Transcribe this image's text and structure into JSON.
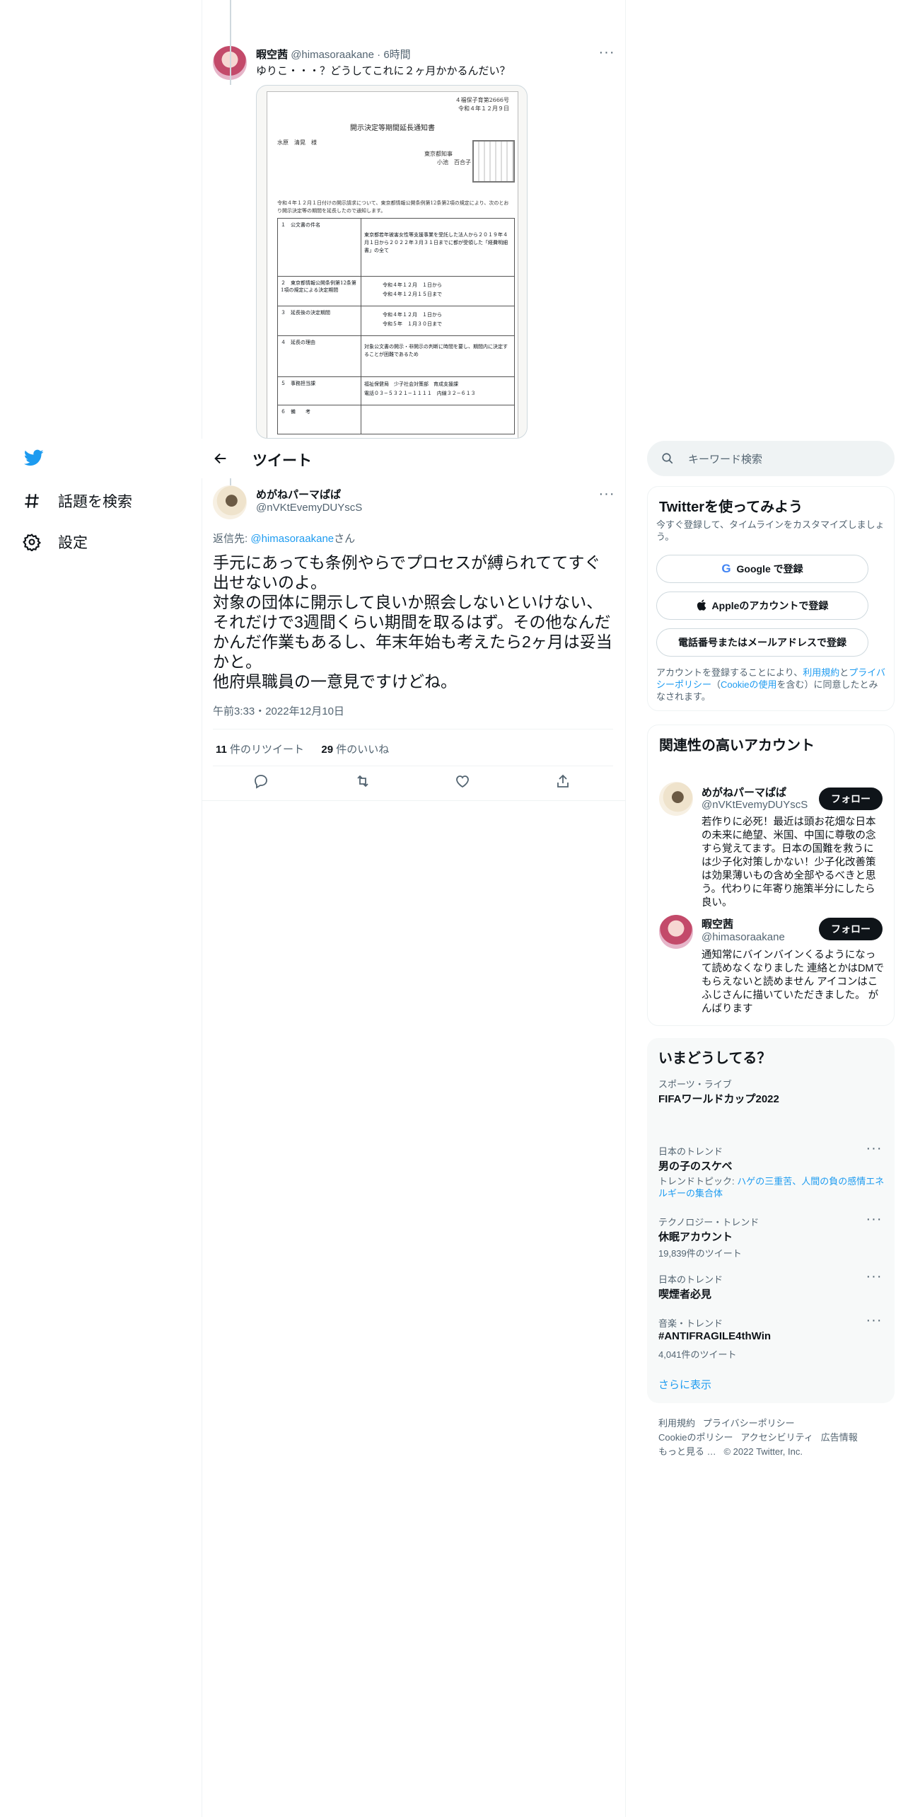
{
  "colors": {
    "accent": "#1d9bf0",
    "text": "#0f1419",
    "muted": "#536471",
    "border": "#eff3f4"
  },
  "nav": {
    "explore_label": "話題を検索",
    "settings_label": "設定"
  },
  "parent_tweet": {
    "display_name": "暇空茜",
    "handle": "@himasoraakane",
    "separator": "·",
    "time": "6時間",
    "text": "ゆりこ・・・？どうしてこれに２ヶ月かかるんだい？",
    "doc": {
      "number": "４福保子育第2666号",
      "date": "令和４年１２月９日",
      "title": "開示決定等期間延長通知書",
      "addressee": "水原　清晃　様",
      "sender_org": "東京都知事",
      "sender_name": "小池　百合子",
      "body": "令和４年１２月１日付けの開示請求について、東京都情報公開条例第12条第2項の規定により、次のとおり開示決定等の期間を延長したので通知します。",
      "rows": [
        {
          "label": "１　公文書の件名",
          "value": "東京都若年被害女性等支援事業を受託した法人から２０１９年４月１日から２０２２年３月３１日までに都が受領した「経費明細書」の全て"
        },
        {
          "label": "２　東京都情報公開条例第12条第1項の規定による決定期間",
          "value": "令和４年１２月　１日から\n令和４年１２月１５日まで"
        },
        {
          "label": "３　延長後の決定期間",
          "value": "令和４年１２月　１日から\n令和５年　１月３０日まで"
        },
        {
          "label": "４　延長の理由",
          "value": "対象公文書の開示・非開示の判断に時間を要し、期間内に決定することが困難であるため"
        },
        {
          "label": "５　事務担当課",
          "value": "福祉保健局　少子社会対策部　育成支援課\n電話０３−５３２１−１１１１　内線３２−６１３"
        },
        {
          "label": "６　備　　考",
          "value": ""
        }
      ]
    }
  },
  "header": {
    "title": "ツイート"
  },
  "tweet": {
    "display_name": "めがねパーマぱぱ",
    "handle": "@nVKtEvemyDUYscS",
    "reply_prefix": "返信先: ",
    "reply_to": "@himasoraakane",
    "reply_suffix": "さん",
    "text": "手元にあっても条例やらでプロセスが縛られててすぐ出せないのよ。\n対象の団体に開示して良いか照会しないといけない、それだけで3週間くらい期間を取るはず。その他なんだかんだ作業もあるし、年末年始も考えたら2ヶ月は妥当かと。\n他府県職員の一意見ですけどね。",
    "timestamp": "午前3:33・2022年12月10日",
    "retweets_count": "11",
    "retweets_label": "件のリツイート",
    "likes_count": "29",
    "likes_label": "件のいいね"
  },
  "search": {
    "placeholder": "キーワード検索"
  },
  "signup": {
    "title": "Twitterを使ってみよう",
    "subtitle": "今すぐ登録して、タイムラインをカスタマイズしましょう。",
    "google_label": "Google で登録",
    "apple_label": "Appleのアカウントで登録",
    "phone_label": "電話番号またはメールアドレスで登録",
    "terms_1": "アカウントを登録することにより、",
    "terms_tos": "利用規約",
    "terms_2": "と",
    "terms_privacy": "プライバシーポリシー",
    "terms_3": "（",
    "terms_cookie": "Cookieの使用",
    "terms_4": "を含む）に同意したとみなされます。"
  },
  "relevant": {
    "title": "関連性の高いアカウント",
    "follow_label": "フォロー",
    "accounts": [
      {
        "name": "めがねパーマぱぱ",
        "handle": "@nVKtEvemyDUYscS",
        "bio": "若作りに必死！最近は頭お花畑な日本の未来に絶望、米国、中国に尊敬の念すら覚えてます。日本の国難を救うには少子化対策しかない！少子化改善策は効果薄いもの含め全部やるべきと思う。代わりに年寄り施策半分にしたら良い。"
      },
      {
        "name": "暇空茜",
        "handle": "@himasoraakane",
        "bio": "通知常にバインバインくるようになって読めなくなりました 連絡とかはDMでもらえないと読めません アイコンはこふじさんに描いていただきました。 がんばります"
      }
    ]
  },
  "trends": {
    "title": "いまどうしてる？",
    "items": [
      {
        "category": "スポーツ・ライブ",
        "name": "FIFAワールドカップ2022"
      },
      {
        "category": "日本のトレンド",
        "name": "男の子のスケベ",
        "topic_prefix": "トレンドトピック: ",
        "topic": "ハゲの三重苦、人間の負の感情エネルギーの集合体"
      },
      {
        "category": "テクノロジー・トレンド",
        "name": "休眠アカウント",
        "count": "19,839件のツイート"
      },
      {
        "category": "日本のトレンド",
        "name": "喫煙者必見"
      },
      {
        "category": "音楽・トレンド",
        "name": "#ANTIFRAGILE4thWin",
        "count": "4,041件のツイート"
      }
    ],
    "show_more": "さらに表示"
  },
  "footer": {
    "terms": "利用規約",
    "privacy": "プライバシーポリシー",
    "cookie": "Cookieのポリシー",
    "accessibility": "アクセシビリティ",
    "ads": "広告情報",
    "more": "もっと見る …",
    "copyright": "© 2022 Twitter, Inc."
  }
}
